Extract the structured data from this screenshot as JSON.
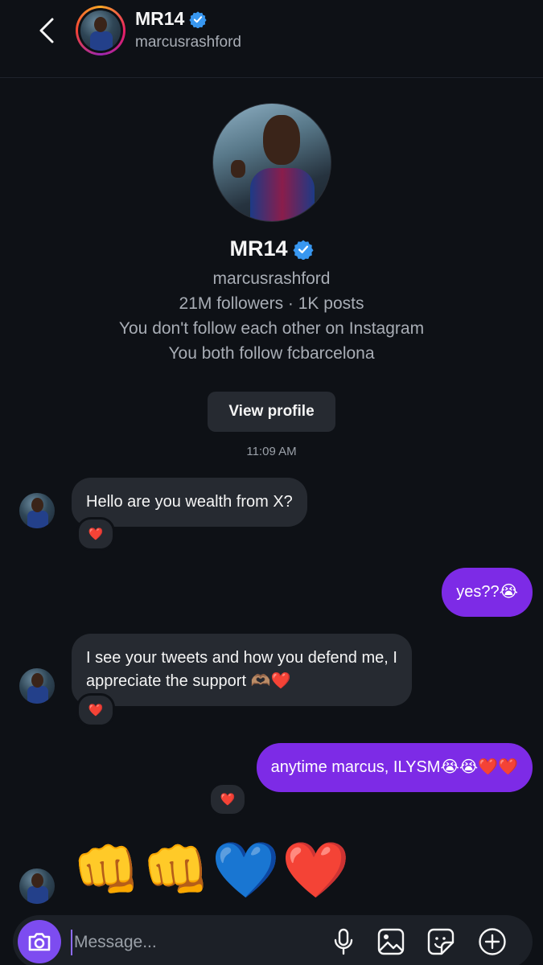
{
  "header": {
    "name": "MR14",
    "handle": "marcusrashford"
  },
  "profile": {
    "name": "MR14",
    "handle": "marcusrashford",
    "stats": "21M followers · 1K posts",
    "follow_status": "You don't follow each other on Instagram",
    "mutual": "You both follow fcbarcelona",
    "view_profile_label": "View profile",
    "timestamp": "11:09 AM"
  },
  "messages": [
    {
      "from": "them",
      "text": "Hello are you wealth from X?",
      "reaction": "❤️"
    },
    {
      "from": "me",
      "text": "yes??😭"
    },
    {
      "from": "them",
      "text_line1": "I see your tweets and how you defend me, I",
      "text_line2": "appreciate the support 🫶🏽❤️",
      "reaction": "❤️"
    },
    {
      "from": "me",
      "text": "anytime marcus, ILYSM😭😭❤️❤️",
      "reaction": "❤️"
    },
    {
      "from": "them",
      "text": "👊👊💙❤️"
    }
  ],
  "composer": {
    "placeholder": "Message..."
  },
  "icons": {
    "back": "chevron-left-icon",
    "verified": "verified-badge-icon",
    "camera": "camera-icon",
    "mic": "microphone-icon",
    "gallery": "image-icon",
    "sticker": "sticker-icon",
    "add": "plus-circle-icon"
  },
  "colors": {
    "background": "#0e1116",
    "incoming_bubble": "#262a31",
    "outgoing_bubble": "#7d2be6",
    "verified": "#3897f0",
    "camera_button": "#7d4cf0"
  }
}
